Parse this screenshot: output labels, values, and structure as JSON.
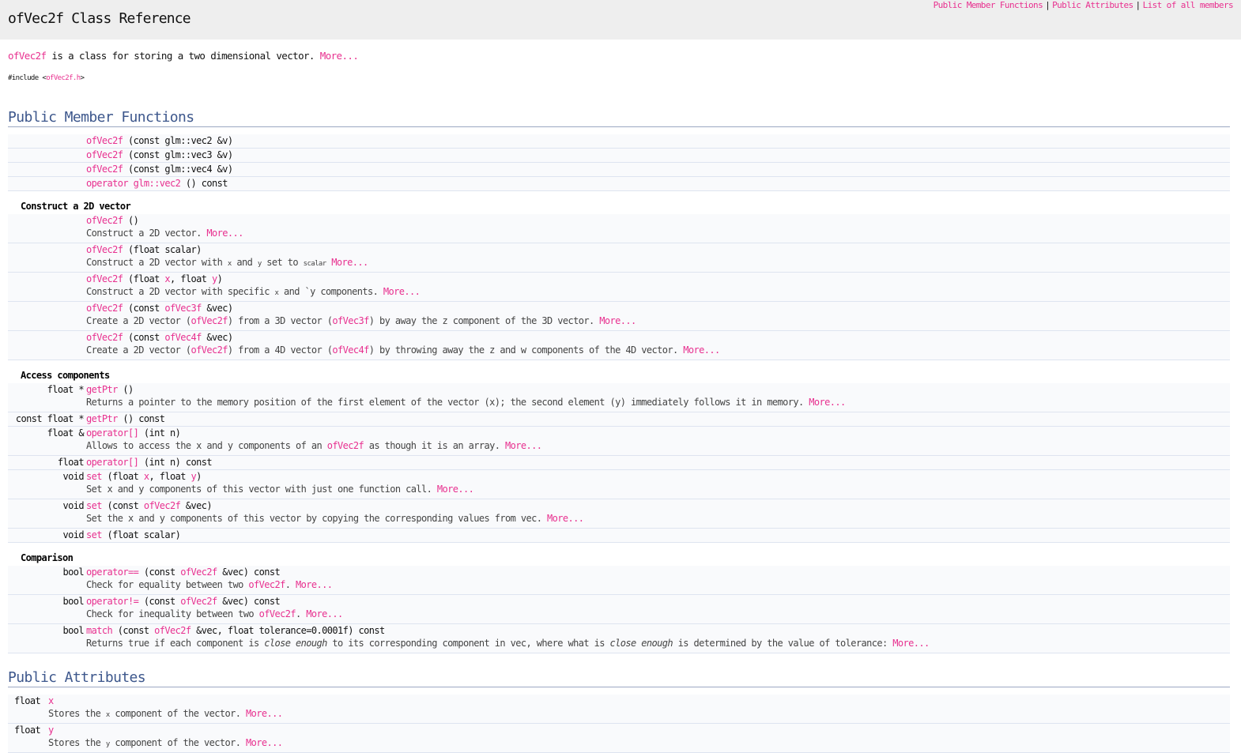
{
  "header": {
    "title": "ofVec2f Class Reference",
    "nav": [
      "Public Member Functions",
      "Public Attributes",
      "List of all members"
    ]
  },
  "brief": {
    "class_name": "ofVec2f",
    "text": " is a class for storing a two dimensional vector. ",
    "more": "More..."
  },
  "include": {
    "prefix": "#include <",
    "file": "ofVec2f.h",
    "suffix": ">"
  },
  "sections": {
    "functions": "Public Member Functions",
    "attributes": "Public Attributes"
  },
  "conversions": [
    {
      "name": "ofVec2f",
      "sig": " (const glm::vec2 &v)"
    },
    {
      "name": "ofVec2f",
      "sig": " (const glm::vec3 &v)"
    },
    {
      "name": "ofVec2f",
      "sig": " (const glm::vec4 &v)"
    },
    {
      "name": "operator glm::vec2",
      "sig": " () const"
    }
  ],
  "groups": {
    "construct": "Construct a 2D vector",
    "access": "Access components",
    "comparison": "Comparison"
  },
  "construct": {
    "r1": {
      "name": "ofVec2f",
      "sig": " ()",
      "desc": "Construct a 2D vector. "
    },
    "r2": {
      "name": "ofVec2f",
      "sig": " (float scalar)",
      "d1": "Construct a 2D vector with ",
      "x": "x",
      "d2": " and ",
      "y": "y",
      "d3": " set to ",
      "scalar": "scalar",
      "d4": " "
    },
    "r3": {
      "name": "ofVec2f",
      "s1": " (float ",
      "px": "x",
      "s2": ", float ",
      "py": "y",
      "s3": ")",
      "d1": "Construct a 2D vector with specific ",
      "x": "x",
      "d2": " and `y components. "
    },
    "r4": {
      "name": "ofVec2f",
      "s1": " (const ",
      "t": "ofVec3f",
      "s2": " &vec)",
      "d1": "Create a 2D vector (",
      "l1": "ofVec2f",
      "d2": ") from a 3D vector (",
      "l2": "ofVec3f",
      "d3": ") by away the z component of the 3D vector. "
    },
    "r5": {
      "name": "ofVec2f",
      "s1": " (const ",
      "t": "ofVec4f",
      "s2": " &vec)",
      "d1": "Create a 2D vector (",
      "l1": "ofVec2f",
      "d2": ") from a 4D vector (",
      "l2": "ofVec4f",
      "d3": ") by throwing away the z and w components of the 4D vector. "
    }
  },
  "access": {
    "r1": {
      "ret": "float *",
      "name": "getPtr",
      "sig": " ()",
      "desc": "Returns a pointer to the memory position of the first element of the vector (x); the second element (y) immediately follows it in memory. "
    },
    "r2": {
      "ret": "const float *",
      "name": "getPtr",
      "sig": " () const"
    },
    "r3": {
      "ret": "float &",
      "name": "operator[]",
      "sig": " (int n)",
      "d1": "Allows to access the x and y components of an ",
      "l": "ofVec2f",
      "d2": " as though it is an array. "
    },
    "r4": {
      "ret": "float",
      "name": "operator[]",
      "sig": " (int n) const"
    },
    "r5": {
      "ret": "void",
      "name": "set",
      "s1": " (float ",
      "px": "x",
      "s2": ", float ",
      "py": "y",
      "s3": ")",
      "desc": "Set x and y components of this vector with just one function call. "
    },
    "r6": {
      "ret": "void",
      "name": "set",
      "s1": " (const ",
      "t": "ofVec2f",
      "s2": " &vec)",
      "desc": "Set the x and y components of this vector by copying the corresponding values from vec. "
    },
    "r7": {
      "ret": "void",
      "name": "set",
      "sig": " (float scalar)"
    }
  },
  "comparison": {
    "r1": {
      "ret": "bool",
      "name": "operator==",
      "s1": " (const ",
      "t": "ofVec2f",
      "s2": " &vec) const",
      "d1": "Check for equality between two ",
      "l": "ofVec2f",
      "d2": ". "
    },
    "r2": {
      "ret": "bool",
      "name": "operator!=",
      "s1": " (const ",
      "t": "ofVec2f",
      "s2": " &vec) const",
      "d1": "Check for inequality between two ",
      "l": "ofVec2f",
      "d2": ". "
    },
    "r3": {
      "ret": "bool",
      "name": "match",
      "s1": " (const ",
      "t": "ofVec2f",
      "s2": " &vec, float tolerance=0.0001f) const",
      "d1": "Returns true if each component is ",
      "e1": "close enough",
      "d2": " to its corresponding component in vec, where what is ",
      "e2": "close enough",
      "d3": " is determined by the value of tolerance: "
    }
  },
  "attributes": {
    "r1": {
      "type": "float",
      "name": "x",
      "d1": "Stores the ",
      "v": "x",
      "d2": " component of the vector. "
    },
    "r2": {
      "type": "float",
      "name": "y",
      "d1": "Stores the ",
      "v": "y",
      "d2": " component of the vector. "
    }
  },
  "more": "More...",
  "colors": {
    "link": "#e8308f",
    "section": "#3d578c",
    "header_bg": "#eeeeee",
    "row_bg": "#f9fafc"
  }
}
